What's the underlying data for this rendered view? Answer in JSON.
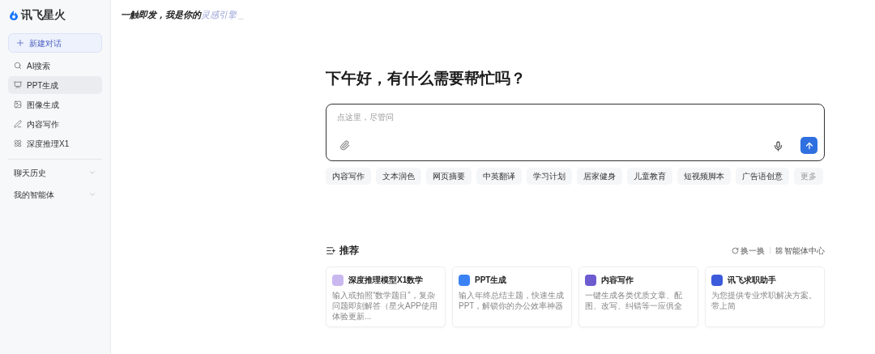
{
  "sidebar": {
    "logo": "讯飞星火",
    "new_chat": "新建对话",
    "items": [
      {
        "label": "AI搜索",
        "selected": false
      },
      {
        "label": "PPT生成",
        "selected": true
      },
      {
        "label": "图像生成",
        "selected": false
      },
      {
        "label": "内容写作",
        "selected": false
      },
      {
        "label": "深度推理X1",
        "selected": false
      }
    ],
    "sections": [
      {
        "label": "聊天历史",
        "expanded": false
      },
      {
        "label": "我的智能体",
        "expanded": false
      }
    ]
  },
  "tagline": {
    "text": "一触即发，我是你的",
    "highlight": "灵感引擎",
    "cursor": "_"
  },
  "greeting": "下午好，有什么需要帮忙吗？",
  "input": {
    "placeholder": "点这里，尽管问"
  },
  "chips": [
    {
      "label": "内容写作",
      "disabled": false
    },
    {
      "label": "文本润色",
      "disabled": false
    },
    {
      "label": "网页摘要",
      "disabled": false
    },
    {
      "label": "中英翻译",
      "disabled": false
    },
    {
      "label": "学习计划",
      "disabled": false
    },
    {
      "label": "居家健身",
      "disabled": false
    },
    {
      "label": "儿童教育",
      "disabled": false
    },
    {
      "label": "短视频脚本",
      "disabled": false
    },
    {
      "label": "广告语创意",
      "disabled": false
    },
    {
      "label": "更多",
      "disabled": true
    }
  ],
  "recommend": {
    "title": "推荐",
    "refresh": "换一换",
    "agent_center": "智能体中心",
    "cards": [
      {
        "title": "深度推理模型X1数学",
        "description": "输入或拍照“数学题目”，复杂问题即刻解答（星火APP使用体验更新...",
        "color": "#c9b8f0"
      },
      {
        "title": "PPT生成",
        "description": "输入年终总结主题，快速生成 PPT，解锁你的办公效率神器",
        "color": "#3b82f6"
      },
      {
        "title": "内容写作",
        "description": "一键生成各类优质文章、配图、改写、纠错等一应俱全",
        "color": "#6d5bd0"
      },
      {
        "title": "讯飞求职助手",
        "description": "为您提供专业求职解决方案。带上简",
        "color": "#3b5bdb"
      }
    ]
  }
}
